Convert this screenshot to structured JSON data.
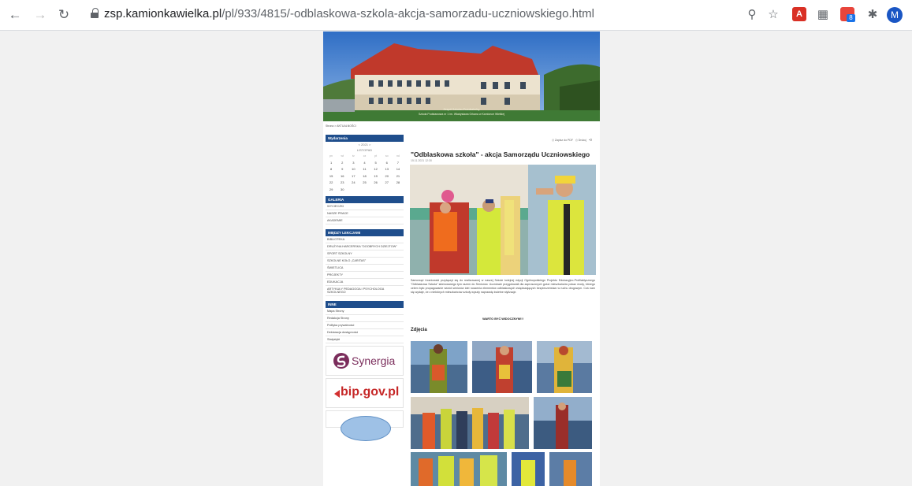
{
  "browser": {
    "url_host": "zsp.kamionkawielka.pl",
    "url_path": "/pl/933/4815/-odblaskowa-szkola-akcja-samorzadu-uczniowskiego.html",
    "avatar_letter": "M",
    "extension_badge": "8",
    "icons": [
      "back-arrow-icon",
      "forward-arrow-icon",
      "reload-icon",
      "lock-icon",
      "zoom-icon",
      "star-icon",
      "pdf-icon",
      "extension-icon",
      "puzzle-icon"
    ]
  },
  "banner": {
    "line1": "Zespół Szkolno-Przedszkolny",
    "line2": "Szkoła Podstawowa nr 1 im. Władysława Orkana w Kamionce Wielkiej"
  },
  "breadcrumb": "Strona > AKTUALNOŚCI",
  "sidebar": {
    "events": {
      "heading": "Wydarzenia",
      "year_nav": "< 2021 >",
      "month": "LISTOPAD",
      "day_headers": [
        "pn",
        "wt",
        "śr",
        "cz",
        "pt",
        "so",
        "nd"
      ],
      "days": [
        "1",
        "2",
        "3",
        "4",
        "5",
        "6",
        "7",
        "8",
        "9",
        "10",
        "11",
        "12",
        "13",
        "14",
        "15",
        "16",
        "17",
        "18",
        "19",
        "20",
        "21",
        "22",
        "23",
        "24",
        "25",
        "26",
        "27",
        "28",
        "29",
        "30",
        "",
        "",
        "",
        "",
        ""
      ]
    },
    "gallery": {
      "heading": "GALERIA",
      "items": [
        "WYCIECZKI",
        "NASZE PRACE",
        "AKADEMIE"
      ]
    },
    "between": {
      "heading": "MIĘDZY LEKCJAMI",
      "items": [
        "BIBLIOTEKA",
        "DRUŻYNA HARCERSKA \"DOOBRYCH DZIEJTOW\"",
        "SPORT SZKOLNY",
        "SZKOLNE KOŁO „CARITAS\"",
        "ŚWIETLICA",
        "PROJEKTY",
        "EDUKACJA",
        "ARTYKUŁY PEDAGOGA I PSYCHOLOGA SZKOLNEGO"
      ]
    },
    "other": {
      "heading": "INNE",
      "items": [
        "Mapa Strony",
        "Redakcja Strony",
        "Polityka prywatności",
        "Deklaracja dostępności",
        "Statystyki"
      ]
    },
    "logos": {
      "synergia": "Synergia",
      "bip": "bip.gov.pl"
    }
  },
  "article": {
    "tools": {
      "pdf": "Zapisz do PDF",
      "print": "Drukuj"
    },
    "title": "\"Odblaskowa szkoła\" - akcja Samorządu Uczniowskiego",
    "date": "15.11.2021 12:30",
    "body": "Samorząd Uczniowski przyłączył się do realizowanej w naszej Szkole kolejnej edycji Ogólnopolskiego Projektu Edukacyjno-Profilaktycznego \"Odblaskowa Szkoła\" skierowanego tym razem do Seniorów. Uczniowie przygotowali dla zaproszonych gości mieszkańców pokaz mody, którego celem było propagowanie wśród seniorów idei noszenia elementów odblaskowych zwiększających bezpieczeństwo w ruchu drogowym. Coś nam się wydaje, że z niektórych mieszkańców szkoły wyszły naprawdę świetne stylizacje.",
    "bold_line": "WARTO BYĆ WIDOCZNYM!!!",
    "photos_heading": "Zdjęcia"
  }
}
